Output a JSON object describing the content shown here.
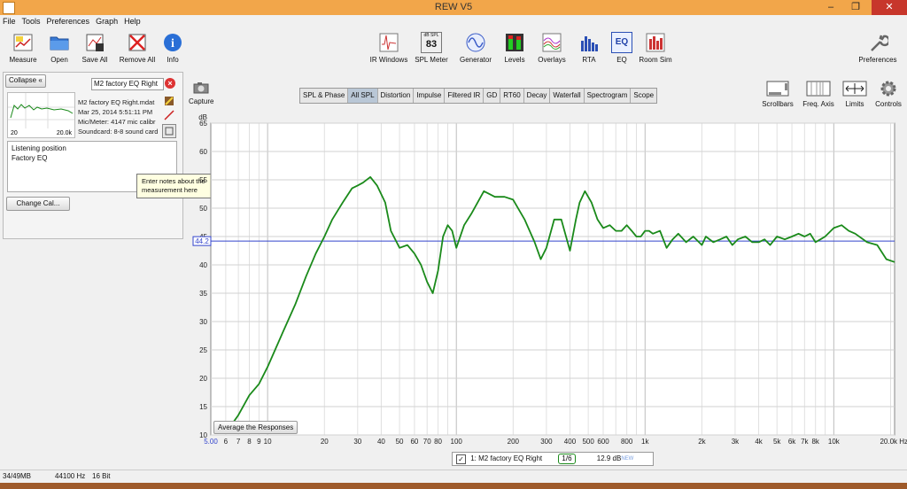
{
  "window": {
    "title": "REW V5"
  },
  "menu": [
    "File",
    "Tools",
    "Preferences",
    "Graph",
    "Help"
  ],
  "toolbar_left": [
    {
      "label": "Measure",
      "icon": "measure-icon"
    },
    {
      "label": "Open",
      "icon": "folder-icon"
    },
    {
      "label": "Save All",
      "icon": "save-icon"
    },
    {
      "label": "Remove All",
      "icon": "remove-icon"
    },
    {
      "label": "Info",
      "icon": "info-icon"
    }
  ],
  "toolbar_center": [
    {
      "label": "IR Windows",
      "icon": "ir-windows-icon"
    },
    {
      "label": "SPL Meter",
      "icon": "spl-meter-icon",
      "top": "dB SPL",
      "value": "83"
    },
    {
      "label": "Generator",
      "icon": "generator-icon"
    },
    {
      "label": "Levels",
      "icon": "levels-icon"
    },
    {
      "label": "Overlays",
      "icon": "overlays-icon"
    },
    {
      "label": "RTA",
      "icon": "rta-icon"
    },
    {
      "label": "EQ",
      "icon": "eq-icon",
      "text": "EQ"
    },
    {
      "label": "Room Sim",
      "icon": "room-sim-icon"
    }
  ],
  "preferences_label": "Preferences",
  "panel": {
    "collapse_label": "Collapse",
    "measurement_name": "M2 factory EQ Right",
    "info": [
      "M2 factory EQ Right.mdat",
      "Mar 25, 2014 5:51:11 PM",
      "Mic/Meter: 4147 mic calibr",
      "Soundcard: 8-8 sound card"
    ],
    "thumb_min": "20",
    "thumb_max": "20.0k",
    "notes": [
      "Listening position",
      "Factory EQ"
    ],
    "change_cal_label": "Change Cal...",
    "tooltip": "Enter notes about the measurement here"
  },
  "capture_label": "Capture",
  "tabs": [
    {
      "label": "SPL & Phase",
      "active": false
    },
    {
      "label": "All SPL",
      "active": true
    },
    {
      "label": "Distortion",
      "active": false
    },
    {
      "label": "Impulse",
      "active": false
    },
    {
      "label": "Filtered IR",
      "active": false
    },
    {
      "label": "GD",
      "active": false
    },
    {
      "label": "RT60",
      "active": false
    },
    {
      "label": "Decay",
      "active": false
    },
    {
      "label": "Waterfall",
      "active": false
    },
    {
      "label": "Spectrogram",
      "active": false
    },
    {
      "label": "Scope",
      "active": false
    }
  ],
  "right_tools": [
    {
      "label": "Scrollbars",
      "icon": "scrollbars-icon"
    },
    {
      "label": "Freq. Axis",
      "icon": "freq-axis-icon"
    },
    {
      "label": "Limits",
      "icon": "limits-icon"
    },
    {
      "label": "Controls",
      "icon": "controls-icon"
    }
  ],
  "average_button": "Average the Responses",
  "legend": {
    "checked": true,
    "name": "1: M2 factory EQ Right",
    "smoothing": "1/6",
    "offset": "12.9 dB",
    "badge": "NEW"
  },
  "status": {
    "memory": "34/49MB",
    "rate": "44100 Hz",
    "bits": "16 Bit"
  },
  "colors": {
    "curve": "#1a8a1a",
    "cursor": "#3344cc",
    "titlebar": "#f2a64a",
    "grid": "#c8c8c8"
  },
  "chart_data": {
    "type": "line",
    "ylabel": "dB",
    "xlabel": "",
    "x_scale": "log",
    "xlim": [
      5,
      21000
    ],
    "ylim": [
      10,
      65
    ],
    "y_ticks": [
      10,
      15,
      20,
      25,
      30,
      35,
      40,
      45,
      50,
      55,
      60,
      65
    ],
    "x_ticks": [
      {
        "v": 5,
        "t": "5.00"
      },
      {
        "v": 6,
        "t": "6"
      },
      {
        "v": 7,
        "t": "7"
      },
      {
        "v": 8,
        "t": "8"
      },
      {
        "v": 9,
        "t": "9"
      },
      {
        "v": 10,
        "t": "10"
      },
      {
        "v": 20,
        "t": "20"
      },
      {
        "v": 30,
        "t": "30"
      },
      {
        "v": 40,
        "t": "40"
      },
      {
        "v": 50,
        "t": "50"
      },
      {
        "v": 60,
        "t": "60"
      },
      {
        "v": 70,
        "t": "70"
      },
      {
        "v": 80,
        "t": "80"
      },
      {
        "v": 100,
        "t": "100"
      },
      {
        "v": 200,
        "t": "200"
      },
      {
        "v": 300,
        "t": "300"
      },
      {
        "v": 400,
        "t": "400"
      },
      {
        "v": 500,
        "t": "500"
      },
      {
        "v": 600,
        "t": "600"
      },
      {
        "v": 800,
        "t": "800"
      },
      {
        "v": 1000,
        "t": "1k"
      },
      {
        "v": 2000,
        "t": "2k"
      },
      {
        "v": 3000,
        "t": "3k"
      },
      {
        "v": 4000,
        "t": "4k"
      },
      {
        "v": 5000,
        "t": "5k"
      },
      {
        "v": 6000,
        "t": "6k"
      },
      {
        "v": 7000,
        "t": "7k"
      },
      {
        "v": 8000,
        "t": "8k"
      },
      {
        "v": 10000,
        "t": "10k"
      },
      {
        "v": 20000,
        "t": "20.0k Hz"
      }
    ],
    "cursor_level": 44.2,
    "cursor_label": "44.2",
    "grid": true,
    "series": [
      {
        "x": [
          6.5,
          7,
          8,
          9,
          10,
          12,
          14,
          16,
          18,
          20,
          22,
          25,
          28,
          30,
          32,
          35,
          38,
          42,
          45,
          50,
          55,
          60,
          65,
          70,
          75,
          80,
          85,
          90,
          95,
          100,
          110,
          120,
          140,
          160,
          180,
          200,
          230,
          260,
          280,
          300,
          330,
          360,
          400,
          430,
          450,
          480,
          520,
          560,
          600,
          650,
          700,
          750,
          800,
          850,
          900,
          950,
          1000,
          1050,
          1100,
          1200,
          1300,
          1400,
          1500,
          1650,
          1800,
          2000,
          2100,
          2300,
          2500,
          2700,
          2900,
          3100,
          3400,
          3700,
          4000,
          4300,
          4600,
          5000,
          5500,
          6000,
          6500,
          7000,
          7500,
          8000,
          8500,
          9000,
          10000,
          11000,
          12000,
          13000,
          15000,
          17000,
          19000,
          21000
        ],
        "y": [
          12,
          13.5,
          17,
          19,
          22,
          28,
          33,
          38,
          42,
          45,
          48,
          51,
          53.5,
          54,
          54.5,
          55.5,
          54,
          51,
          46,
          43,
          43.5,
          42,
          40,
          37,
          35,
          39,
          45,
          47,
          46,
          43,
          47,
          49,
          53,
          52,
          52,
          51.5,
          48,
          44,
          41,
          43,
          48,
          48,
          42.5,
          48,
          51,
          53,
          51,
          48,
          46.5,
          47,
          46,
          46,
          47,
          46,
          45,
          45,
          46,
          46,
          45.5,
          46,
          43,
          44.5,
          45.5,
          44,
          45,
          43.5,
          45,
          44,
          44.5,
          45,
          43.5,
          44.5,
          45,
          44,
          44,
          44.5,
          43.5,
          45,
          44.5,
          45,
          45.5,
          45,
          45.5,
          44,
          44.5,
          45,
          46.5,
          47,
          46,
          45.5,
          44,
          43.5,
          41,
          40.5
        ]
      }
    ]
  }
}
